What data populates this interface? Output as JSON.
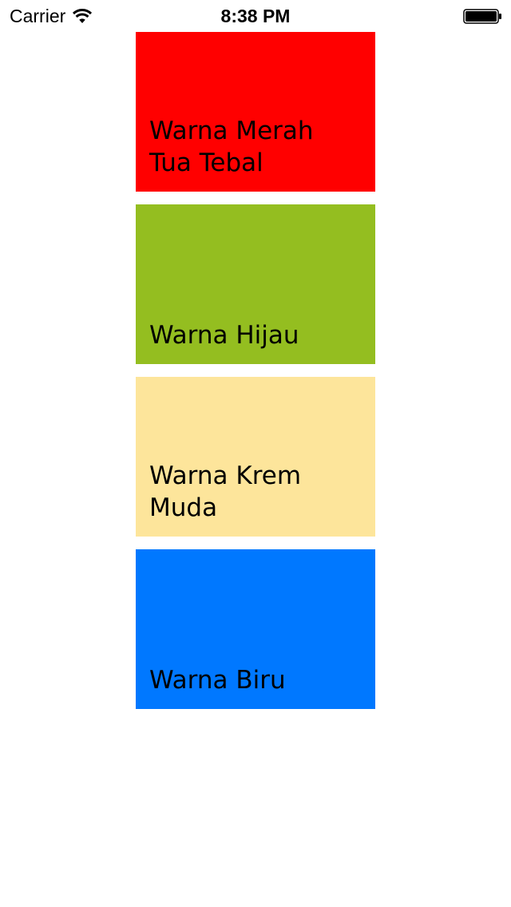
{
  "status_bar": {
    "carrier": "Carrier",
    "time": "8:38 PM",
    "wifi_icon": "wifi-icon",
    "battery_icon": "battery-icon",
    "battery_level": 1.0
  },
  "colors": [
    {
      "label": "Warna Merah Tua Tebal",
      "color": "#FF0000"
    },
    {
      "label": "Warna Hijau",
      "color": "#94BE20"
    },
    {
      "label": "Warna Krem Muda",
      "color": "#FDE59B"
    },
    {
      "label": "Warna Biru",
      "color": "#0078FF"
    }
  ]
}
